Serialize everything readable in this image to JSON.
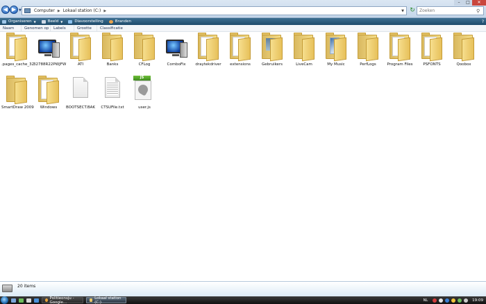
{
  "address": {
    "crumbs": [
      {
        "label": "Computer"
      },
      {
        "label": "Lokaal station (C:)"
      }
    ]
  },
  "search": {
    "placeholder": "Zoeken"
  },
  "toolbar": {
    "items": [
      {
        "label": "Organiseren",
        "has_menu": true,
        "icon": "organize-icon",
        "color": "#9fc6e8"
      },
      {
        "label": "Beeld",
        "has_menu": true,
        "icon": "views-icon",
        "color": "#cfd9e6"
      },
      {
        "label": "Diavoorstelling",
        "has_menu": false,
        "icon": "slideshow-icon",
        "color": "#8cc1f0"
      },
      {
        "label": "Branden",
        "has_menu": false,
        "icon": "burn-icon",
        "color": "#e9a24c"
      }
    ]
  },
  "columns": [
    {
      "label": "Naam"
    },
    {
      "label": "Genomen op"
    },
    {
      "label": "Labels"
    },
    {
      "label": "Grootte"
    },
    {
      "label": "Classificatie"
    }
  ],
  "items": [
    {
      "label": ".pages_cache_32",
      "type": "folder"
    },
    {
      "label": "32788R22PWJFW",
      "type": "drive"
    },
    {
      "label": "ATI",
      "type": "folder"
    },
    {
      "label": "Banks",
      "type": "folder"
    },
    {
      "label": "CFLog",
      "type": "folder"
    },
    {
      "label": "ComboFix",
      "type": "drive"
    },
    {
      "label": "draytekdriver",
      "type": "folder"
    },
    {
      "label": "extensions",
      "type": "folder"
    },
    {
      "label": "Gebruikers",
      "type": "folder-photo"
    },
    {
      "label": "LiveCam",
      "type": "folder"
    },
    {
      "label": "My Music",
      "type": "folder-doc"
    },
    {
      "label": "PerfLogs",
      "type": "folder"
    },
    {
      "label": "Program Files",
      "type": "folder"
    },
    {
      "label": "PSFONTS",
      "type": "folder"
    },
    {
      "label": "Qoobox",
      "type": "folder"
    },
    {
      "label": "SmartDraw 2009",
      "type": "folder"
    },
    {
      "label": "Windows",
      "type": "folder"
    },
    {
      "label": "BOOTSECT.BAK",
      "type": "file"
    },
    {
      "label": "CTSUFile.txt",
      "type": "text"
    },
    {
      "label": "user.js",
      "type": "js",
      "badge": "JS"
    }
  ],
  "details": {
    "count": "20 items"
  },
  "taskbar": {
    "tasks": [
      {
        "label": "Politieonsju - Google...",
        "icon_color": "#e8a33b",
        "active": false
      },
      {
        "label": "Lokaal station (C:)",
        "icon_color": "#e7c66a",
        "active": true
      }
    ],
    "lang": "NL",
    "clock": "19:09"
  }
}
